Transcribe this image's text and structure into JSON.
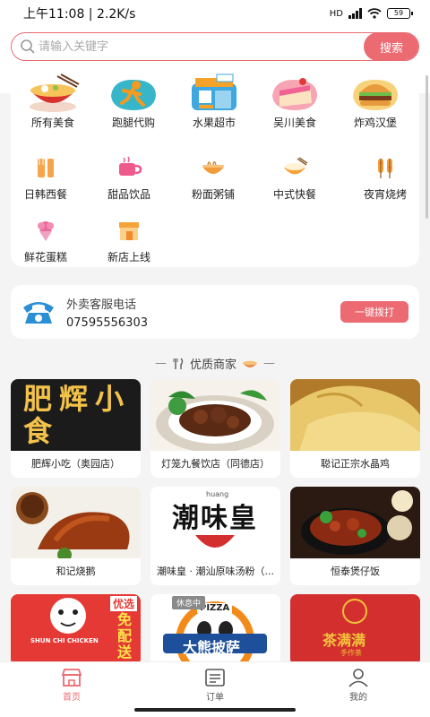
{
  "status": {
    "time": "上午11:08",
    "speed": "2.2K/s",
    "network": "HD",
    "battery": "59"
  },
  "search": {
    "placeholder": "请输入关键字",
    "button": "搜索"
  },
  "categories": [
    {
      "label": "所有美食",
      "icon": "noodle-bowl-icon"
    },
    {
      "label": "跑腿代购",
      "icon": "runner-icon"
    },
    {
      "label": "水果超市",
      "icon": "shop-icon"
    },
    {
      "label": "吴川美食",
      "icon": "cake-icon"
    },
    {
      "label": "炸鸡汉堡",
      "icon": "burger-icon"
    },
    {
      "label": "日韩西餐",
      "icon": "fork-knife-icon"
    },
    {
      "label": "甜品饮品",
      "icon": "drink-cup-icon"
    },
    {
      "label": "粉面粥铺",
      "icon": "noodle-icon"
    },
    {
      "label": "中式快餐",
      "icon": "rice-bowl-icon"
    },
    {
      "label": "夜宵烧烤",
      "icon": "skewer-icon"
    },
    {
      "label": "鲜花蛋糕",
      "icon": "flower-icon"
    },
    {
      "label": "新店上线",
      "icon": "new-store-icon"
    }
  ],
  "hotline": {
    "title": "外卖客服电话",
    "phone": "07595556303",
    "button": "一键拨打"
  },
  "section": {
    "title": "优质商家"
  },
  "stores": [
    {
      "name": "肥辉小吃（奥园店）",
      "sign_text": "肥辉小食"
    },
    {
      "name": "灯笼九餐饮店（同德店）"
    },
    {
      "name": "聪记正宗水晶鸡"
    },
    {
      "name": "和记烧鹅"
    },
    {
      "name": "潮味皇 · 潮汕原味汤粉（...",
      "sign_text": "潮味皇",
      "sign_sub": "huang"
    },
    {
      "name": "恒泰煲仔饭"
    },
    {
      "name": "",
      "sign_text": "免配送",
      "sign_badge": "优选",
      "sign_sub": "SHUN CHI CHICKEN"
    },
    {
      "name": "",
      "status": "休息中",
      "sign_text": "大熊披萨",
      "sign_sub": "PIZZA"
    },
    {
      "name": "",
      "sign_text": "茶满满",
      "sign_sub": "手作茶"
    }
  ],
  "tabs": [
    {
      "label": "首页",
      "icon": "home-icon",
      "active": true
    },
    {
      "label": "订单",
      "icon": "order-icon",
      "active": false
    },
    {
      "label": "我的",
      "icon": "profile-icon",
      "active": false
    }
  ],
  "colors": {
    "accent": "#ec6a72"
  }
}
